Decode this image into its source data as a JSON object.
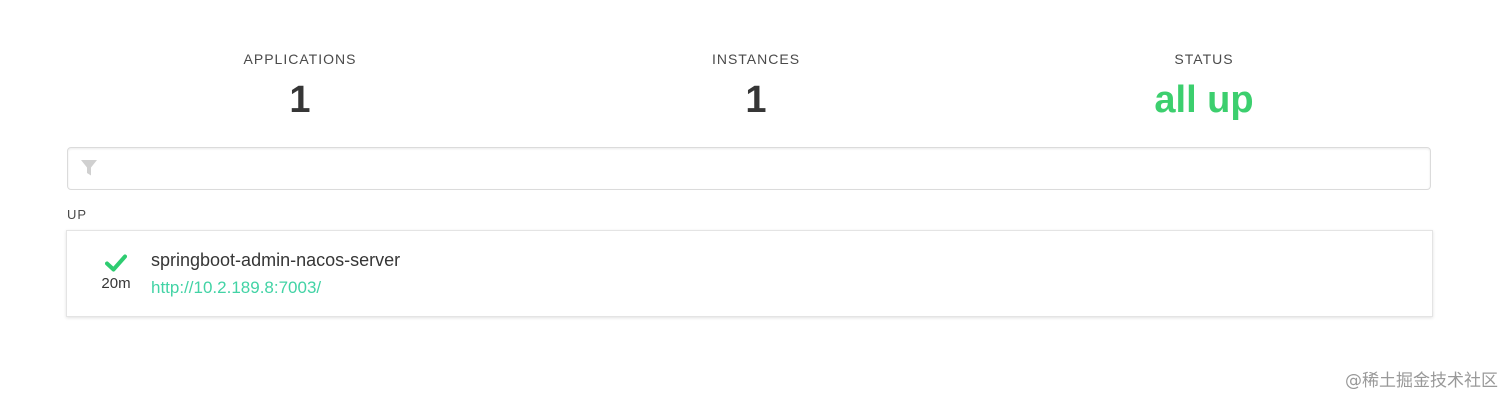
{
  "summary": {
    "applications": {
      "label": "APPLICATIONS",
      "value": "1"
    },
    "instances": {
      "label": "INSTANCES",
      "value": "1"
    },
    "status": {
      "label": "STATUS",
      "value": "all up",
      "color": "#3ccf6e"
    }
  },
  "filter": {
    "icon": "filter-icon",
    "value": "",
    "placeholder": ""
  },
  "groups": [
    {
      "label": "UP",
      "applications": [
        {
          "status_icon": "check-icon",
          "status_color": "#2ecc71",
          "since": "20m",
          "name": "springboot-admin-nacos-server",
          "url": "http://10.2.189.8:7003/"
        }
      ]
    }
  ],
  "watermark": "@稀土掘金技术社区"
}
